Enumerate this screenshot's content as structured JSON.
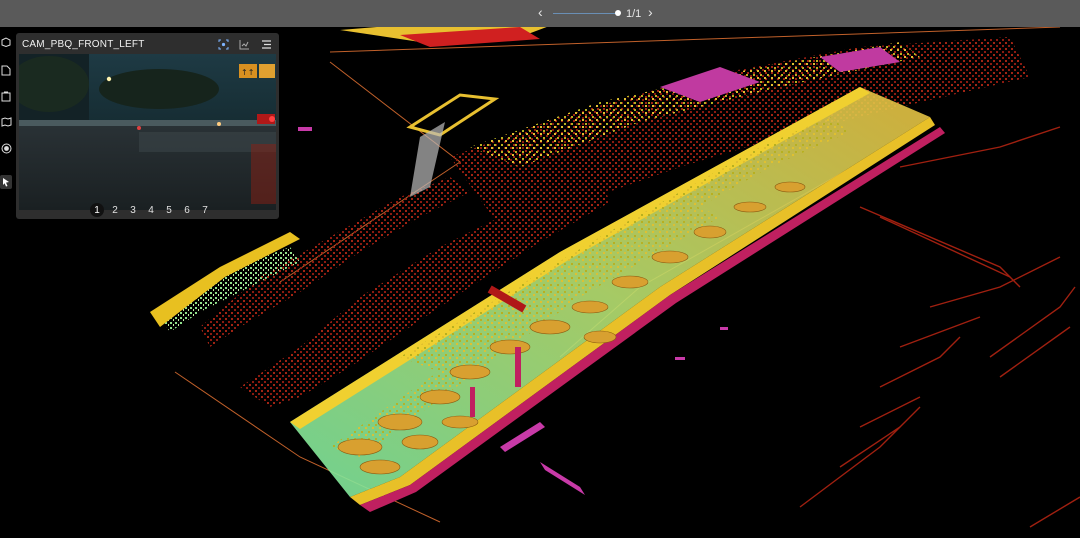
{
  "pager": {
    "prev_icon": "chevron-left-icon",
    "next_icon": "chevron-right-icon",
    "count": "1/1",
    "progress": 1.0
  },
  "toolbar": {
    "tools": [
      "cube-icon",
      "document-icon",
      "clipboard-icon",
      "map-icon",
      "record-icon",
      "pointer-icon"
    ],
    "active": "pointer-icon"
  },
  "camera": {
    "title": "CAM_PBQ_FRONT_LEFT",
    "icons": [
      "focus-icon",
      "chart-icon",
      "list-icon"
    ],
    "pages": [
      "1",
      "2",
      "3",
      "4",
      "5",
      "6",
      "7"
    ],
    "active_page": "1"
  },
  "colors": {
    "topbar": "#5a5a5a",
    "panel": "#2e2e2e",
    "background": "#000000"
  }
}
